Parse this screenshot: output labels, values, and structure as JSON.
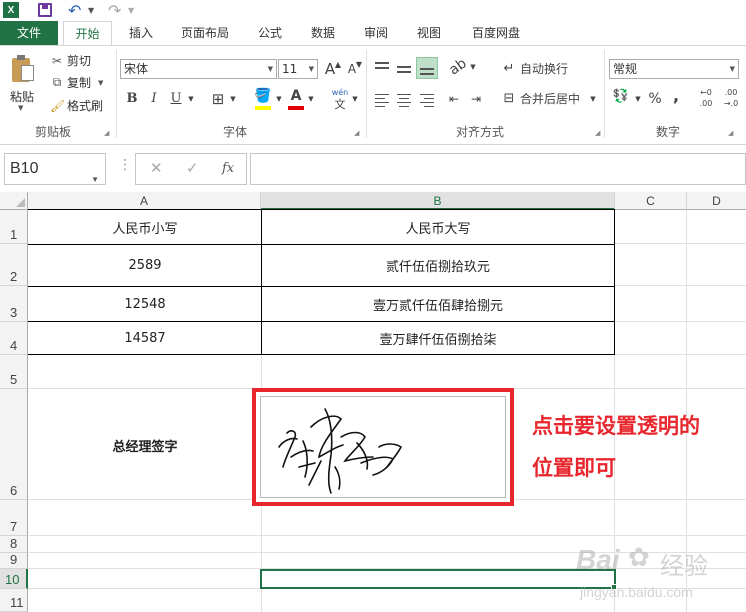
{
  "quick_access": {
    "logo_text": "X"
  },
  "tabs": [
    "文件",
    "开始",
    "插入",
    "页面布局",
    "公式",
    "数据",
    "审阅",
    "视图",
    "百度网盘"
  ],
  "ribbon": {
    "clipboard": {
      "paste": "粘贴",
      "cut": "剪切",
      "copy": "复制",
      "format_painter": "格式刷",
      "label": "剪贴板"
    },
    "font": {
      "name": "宋体",
      "size": "11",
      "grow": "A",
      "shrink": "A",
      "bold": "B",
      "italic": "I",
      "underline": "U",
      "font_color_glyph": "A",
      "phonetic_top": "wén",
      "phonetic_bottom": "文",
      "label": "字体"
    },
    "alignment": {
      "wrap_text": "自动换行",
      "merge_center": "合并后居中",
      "label": "对齐方式"
    },
    "number": {
      "format": "常规",
      "percent": "%",
      "comma": ",",
      "inc_top": "←0",
      "inc_bottom": ".00",
      "dec_top": ".00",
      "dec_bottom": "→.0",
      "label": "数字"
    }
  },
  "formula_bar": {
    "name_box": "B10",
    "dots": "⋮",
    "cancel": "✕",
    "enter": "✓",
    "fx": "fx",
    "value": ""
  },
  "columns": [
    "A",
    "B",
    "C",
    "D"
  ],
  "rows": [
    "1",
    "2",
    "3",
    "4",
    "5",
    "6",
    "7",
    "8",
    "9",
    "10",
    "11"
  ],
  "table": {
    "header_a": "人民币小写",
    "header_b": "人民币大写",
    "rows": [
      {
        "a": "2589",
        "b": "贰仟伍佰捌拾玖元"
      },
      {
        "a": "12548",
        "b": "壹万贰仟伍佰肆拾捌元"
      },
      {
        "a": "14587",
        "b": "壹万肆仟伍佰捌拾柒"
      }
    ],
    "signature_label": "总经理签字"
  },
  "annotation": {
    "line1": "点击要设置透明的",
    "line2": "位置即可"
  },
  "watermark": {
    "logo": "Bai",
    "suffix": "经验",
    "url": "jingyan.baidu.com"
  },
  "colors": {
    "accent": "#217346",
    "callout": "#e8262d"
  }
}
